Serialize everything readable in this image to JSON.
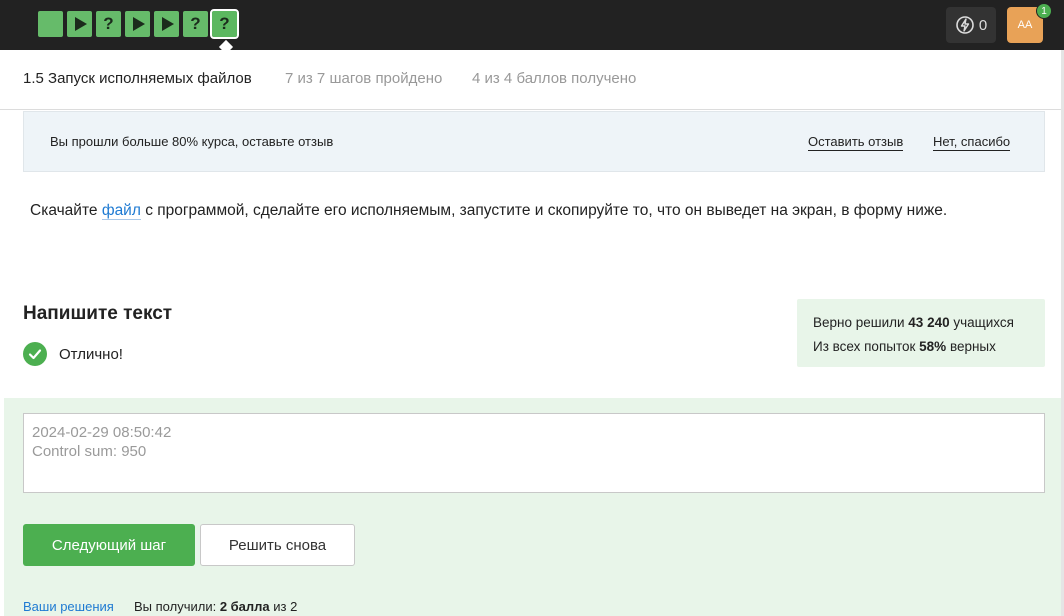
{
  "topbar": {
    "steps": [
      {
        "icon": "blank-square-icon",
        "state": "done"
      },
      {
        "icon": "play-icon",
        "state": "done"
      },
      {
        "icon": "question-icon",
        "label": "?",
        "state": "done"
      },
      {
        "icon": "play-icon",
        "state": "done"
      },
      {
        "icon": "play-icon",
        "state": "done"
      },
      {
        "icon": "question-icon",
        "label": "?",
        "state": "done"
      },
      {
        "icon": "question-icon",
        "label": "?",
        "state": "current"
      }
    ],
    "energy_count": "0",
    "avatar_initials": "AA",
    "notification_count": "1"
  },
  "lesson": {
    "title": "1.5 Запуск исполняемых файлов",
    "progress": "7 из 7 шагов пройдено",
    "score": "4 из 4 баллов  получено"
  },
  "banner": {
    "text": "Вы прошли больше 80% курса, оставьте отзыв",
    "leave_review": "Оставить отзыв",
    "no_thanks": "Нет, спасибо"
  },
  "task": {
    "before": "Скачайте ",
    "link": "файл",
    "after": " с программой, сделайте его исполняемым, запустите и скопируйте то, что он выведет на экран, в форму ниже."
  },
  "section": {
    "title": "Напишите текст",
    "status": "Отлично!"
  },
  "stats": {
    "line1_prefix": "Верно решили ",
    "solved_count": "43 240",
    "line1_suffix": " учащихся",
    "line2_prefix": "Из всех попыток ",
    "percent": "58%",
    "line2_suffix": " верных"
  },
  "answer": {
    "line1": "2024-02-29 08:50:42",
    "line2": "Control sum: 950"
  },
  "buttons": {
    "next": "Следующий шаг",
    "retry": "Решить снова"
  },
  "footer": {
    "solutions_link": "Ваши решения",
    "result_prefix": "Вы получили: ",
    "result_points": "2 балла",
    "result_suffix": " из 2"
  },
  "colors": {
    "accent_green": "#4caf50",
    "topbar_bg": "#222222",
    "link_blue": "#1e7ad2",
    "avatar_orange": "#e8a257"
  }
}
